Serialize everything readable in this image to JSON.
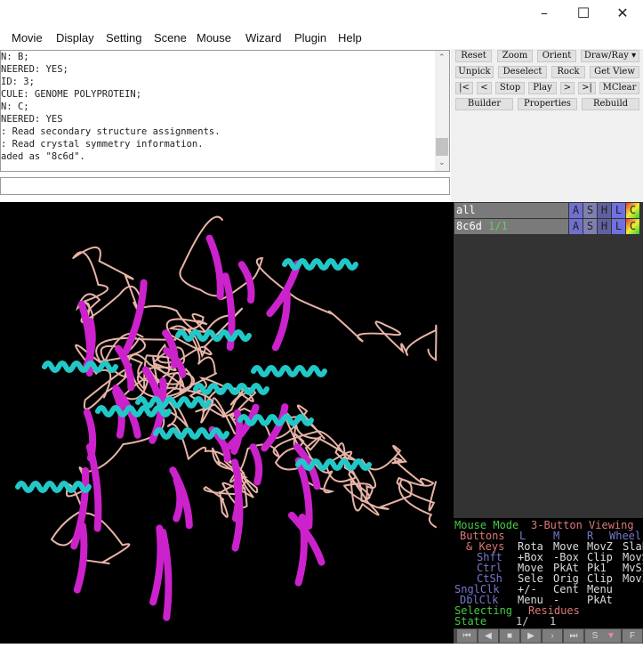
{
  "window": {
    "minimize": "–",
    "maximize": "☐",
    "close": "✕"
  },
  "menu": [
    "Movie",
    "Display",
    "Setting",
    "Scene",
    "Mouse",
    "Wizard",
    "Plugin",
    "Help"
  ],
  "output_lines": [
    "N: B;",
    "NEERED: YES;",
    "ID: 3;",
    "CULE: GENOME POLYPROTEIN;",
    "N: C;",
    "NEERED: YES",
    ": Read secondary structure assignments.",
    ": Read crystal symmetry information.",
    "aded as \"8c6d\"."
  ],
  "command_value": "",
  "buttons": {
    "row1": [
      "Reset",
      "Zoom",
      "Orient",
      "Draw/Ray ▾"
    ],
    "row2": [
      "Unpick",
      "Deselect",
      "Rock",
      "Get View"
    ],
    "row3": [
      "|<",
      "<",
      "Stop",
      "Play",
      ">",
      ">|",
      "MClear"
    ],
    "row4": [
      "Builder",
      "Properties",
      "Rebuild"
    ]
  },
  "objects": [
    {
      "name": "all",
      "state": ""
    },
    {
      "name": "8c6d",
      "state": "1/1"
    }
  ],
  "object_buttons": [
    "A",
    "S",
    "H",
    "L",
    "C"
  ],
  "mouse_mode": {
    "title": "Mouse Mode",
    "mode": "3-Button Viewing",
    "header": [
      "Buttons",
      "L",
      "M",
      "R",
      "Wheel"
    ],
    "rows": [
      [
        "& Keys",
        "Rota",
        "Move",
        "MovZ",
        "Slab"
      ],
      [
        "Shft",
        "+Box",
        "-Box",
        "Clip",
        "MovS"
      ],
      [
        "Ctrl",
        "Move",
        "PkAt",
        "Pk1",
        "MvSZ"
      ],
      [
        "CtSh",
        "Sele",
        "Orig",
        "Clip",
        "MovZ"
      ],
      [
        "SnglClk",
        "+/-",
        "Cent",
        "Menu",
        ""
      ],
      [
        "DblClk",
        "Menu",
        "-",
        "PkAt",
        ""
      ]
    ],
    "selecting": "Selecting",
    "selecting_value": "Residues",
    "state_label": "State",
    "state_value": "1/",
    "state_total": "1"
  },
  "transport": [
    "⏮",
    "◀",
    "■",
    "▶",
    "›",
    "⏭",
    "S",
    "▼",
    "F"
  ],
  "colors": {
    "strand": "#cc22cc",
    "helix": "#22c8c8",
    "loop": "#e8b4a8"
  }
}
